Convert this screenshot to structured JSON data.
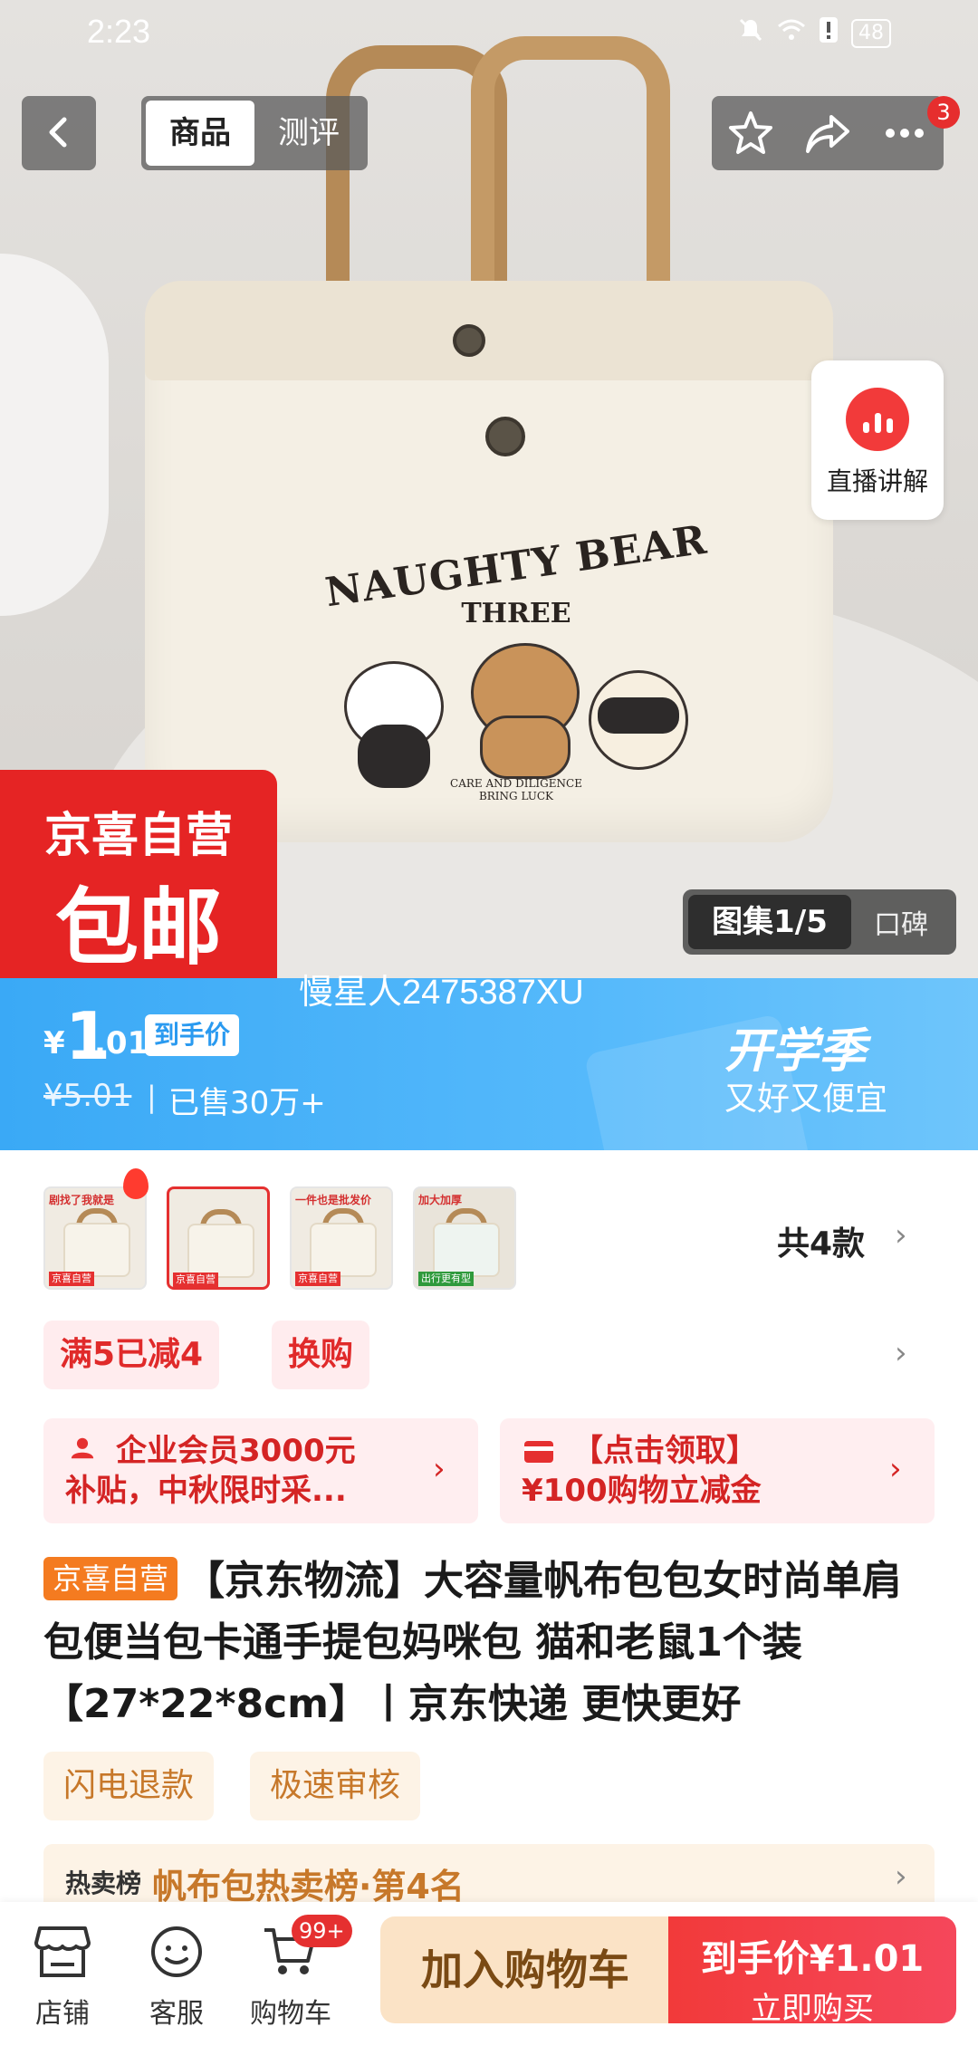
{
  "status_bar": {
    "time": "2:23",
    "battery": "48"
  },
  "nav": {
    "tabs": [
      {
        "label": "商品"
      },
      {
        "label": "测评"
      }
    ],
    "more_badge": "3"
  },
  "live": {
    "label": "直播讲解"
  },
  "hero": {
    "badge_top": "京喜自营",
    "badge_bottom": "包邮",
    "gallery_label": "图集1/5",
    "review_label": "口碑",
    "bag_print_title": "NAUGHTY BEAR",
    "bag_print_sub": "THREE",
    "bag_print_tag": "CARE AND DILIGENCE\nBRING LUCK"
  },
  "watermark": "慢星人2475387XU",
  "price": {
    "currency": "¥",
    "integer": "1",
    "decimal": ".01",
    "tag": "到手价",
    "original": "¥5.01",
    "separator": "|",
    "sold": "已售30万+",
    "campaign_title": "开学季",
    "campaign_sub": "又好又便宜"
  },
  "variants": {
    "thumbs": [
      {
        "text": "剧找了我就是",
        "tag": "京喜自营"
      },
      {
        "text": "",
        "tag": "京喜自营"
      },
      {
        "text": "一件也是批发价",
        "tag": "京喜自营"
      },
      {
        "text": "加大加厚",
        "tag": "出行更有型"
      }
    ],
    "count": "共4款"
  },
  "promos": [
    {
      "label": "满5已减4"
    },
    {
      "label": "换购"
    }
  ],
  "coupons": [
    {
      "line1": "企业会员3000元",
      "line2": "补贴，中秋限时采..."
    },
    {
      "line1": "【点击领取】",
      "line2": "¥100购物立减金"
    }
  ],
  "product": {
    "badge": "京喜自营",
    "title": "【京东物流】大容量帆布包包女时尚单肩包便当包卡通手提包妈咪包 猫和老鼠1个装【27*22*8cm】丨京东快递 更快更好"
  },
  "services": [
    {
      "label": "闪电退款"
    },
    {
      "label": "极速审核"
    }
  ],
  "rank": {
    "prefix": "热卖榜",
    "text": "帆布包热卖榜·第4名"
  },
  "bottom_bar": {
    "items": [
      {
        "label": "店铺"
      },
      {
        "label": "客服"
      },
      {
        "label": "购物车"
      }
    ],
    "cart_badge": "99+",
    "add_cart": "加入购物车",
    "buy_price": "到手价¥1.01",
    "buy_label": "立即购买"
  },
  "colors": {
    "accent_red": "#e53030",
    "banner_blue": "#3aa9f6",
    "service_orange": "#c7782a",
    "self_badge_orange": "#f47b20"
  },
  "icons": {
    "back": "chevron-left-icon",
    "favorite": "star-icon",
    "share": "share-icon",
    "more": "more-icon",
    "live": "live-icon",
    "store": "store-icon",
    "service": "chat-face-icon",
    "cart": "cart-icon"
  }
}
